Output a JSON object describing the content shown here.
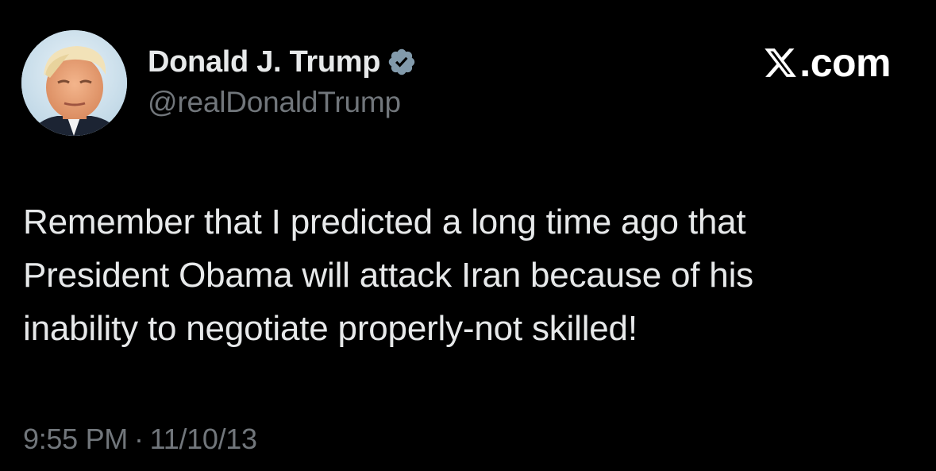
{
  "colors": {
    "background": "#000000",
    "text_primary": "#e7e9ea",
    "text_secondary": "#71767b",
    "verified_badge": "#829aab"
  },
  "author": {
    "display_name": "Donald J. Trump",
    "handle": "@realDonaldTrump",
    "avatar_icon": "profile-photo",
    "badge_icon": "verified-badge-icon"
  },
  "brand": {
    "logo_icon": "x-logo-icon",
    "text": ".com"
  },
  "tweet": {
    "text": "Remember that I predicted a long time ago that\nPresident Obama will attack Iran because of his\ninability to negotiate properly-not skilled!",
    "time": "9:55 PM",
    "separator": "·",
    "date": "11/10/13"
  }
}
